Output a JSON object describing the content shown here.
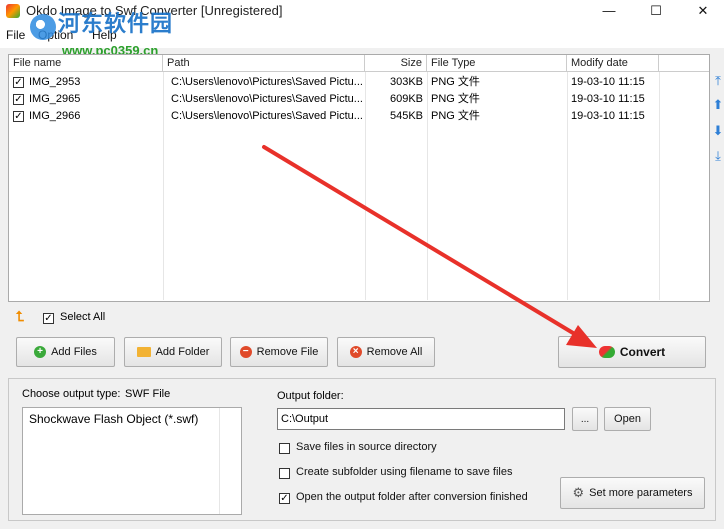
{
  "window": {
    "title": "Okdo Image to Swf Converter [Unregistered]",
    "minimize": "—",
    "maximize": "☐",
    "close": "✕"
  },
  "menu": {
    "items": [
      "File",
      "Option",
      "Help"
    ]
  },
  "watermark": {
    "line1": "河东软件园",
    "line2": "www.pc0359.cn"
  },
  "file_list": {
    "columns": [
      "File name",
      "Path",
      "Size",
      "File Type",
      "Modify date"
    ],
    "rows": [
      {
        "name": "IMG_2953",
        "path": "C:\\Users\\lenovo\\Pictures\\Saved Pictu...",
        "size": "303KB",
        "type": "PNG 文件",
        "date": "19-03-10 11:15",
        "checked": true
      },
      {
        "name": "IMG_2965",
        "path": "C:\\Users\\lenovo\\Pictures\\Saved Pictu...",
        "size": "609KB",
        "type": "PNG 文件",
        "date": "19-03-10 11:15",
        "checked": true
      },
      {
        "name": "IMG_2966",
        "path": "C:\\Users\\lenovo\\Pictures\\Saved Pictu...",
        "size": "545KB",
        "type": "PNG 文件",
        "date": "19-03-10 11:15",
        "checked": true
      }
    ]
  },
  "select_all": {
    "label": "Select All",
    "checked": true
  },
  "buttons": {
    "add_files": "Add Files",
    "add_folder": "Add Folder",
    "remove_file": "Remove File",
    "remove_all": "Remove All",
    "convert": "Convert",
    "browse": "...",
    "open": "Open",
    "set_params": "Set more parameters"
  },
  "output": {
    "type_label": "Choose output type:",
    "type_value": "SWF File",
    "type_options": [
      "Shockwave Flash Object (*.swf)"
    ],
    "folder_label": "Output folder:",
    "folder_value": "C:\\Output"
  },
  "options": [
    {
      "label": "Save files in source directory",
      "checked": false
    },
    {
      "label": "Create subfolder using filename to save files",
      "checked": false
    },
    {
      "label": "Open the output folder after conversion finished",
      "checked": true
    }
  ],
  "colors": {
    "accent_arrow": "#e8312a",
    "watermark_blue": "#1a73c8",
    "watermark_green": "#2ca02c"
  }
}
